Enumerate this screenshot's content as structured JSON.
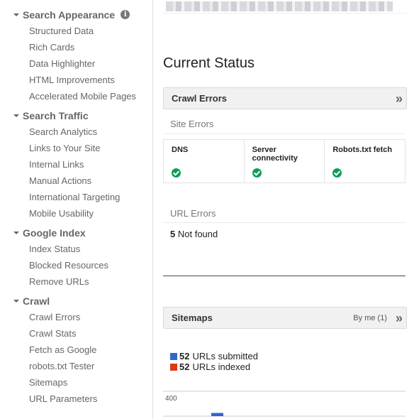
{
  "sidebar": {
    "groups": [
      {
        "label": "Search Appearance",
        "has_info": true,
        "items": [
          "Structured Data",
          "Rich Cards",
          "Data Highlighter",
          "HTML Improvements",
          "Accelerated Mobile Pages"
        ]
      },
      {
        "label": "Search Traffic",
        "items": [
          "Search Analytics",
          "Links to Your Site",
          "Internal Links",
          "Manual Actions",
          "International Targeting",
          "Mobile Usability"
        ]
      },
      {
        "label": "Google Index",
        "items": [
          "Index Status",
          "Blocked Resources",
          "Remove URLs"
        ]
      },
      {
        "label": "Crawl",
        "items": [
          "Crawl Errors",
          "Crawl Stats",
          "Fetch as Google",
          "robots.txt Tester",
          "Sitemaps",
          "URL Parameters"
        ]
      }
    ],
    "info_icon_glyph": "i"
  },
  "main": {
    "page_title": "Current Status",
    "crawl_errors": {
      "title": "Crawl Errors",
      "site_errors_label": "Site Errors",
      "site_errors": [
        {
          "label": "DNS",
          "status": "ok"
        },
        {
          "label": "Server connectivity",
          "status": "ok"
        },
        {
          "label": "Robots.txt fetch",
          "status": "ok"
        }
      ],
      "url_errors_label": "URL Errors",
      "url_errors": {
        "count": "5",
        "label": "Not found"
      }
    },
    "sitemaps": {
      "title": "Sitemaps",
      "filter": "By me (1)",
      "legend": [
        {
          "count": "52",
          "label": "URLs submitted",
          "color": "#3366cc"
        },
        {
          "count": "52",
          "label": "URLs indexed",
          "color": "#dc3912"
        }
      ]
    },
    "chevron_glyph": "»"
  },
  "chart_data": {
    "type": "bar",
    "title": "",
    "categories": [
      ""
    ],
    "series": [
      {
        "name": "URLs submitted",
        "values": [
          52
        ],
        "color": "#3366cc"
      }
    ],
    "y_ticks": [
      "400"
    ],
    "ylim": [
      0,
      400
    ],
    "grid": true
  }
}
